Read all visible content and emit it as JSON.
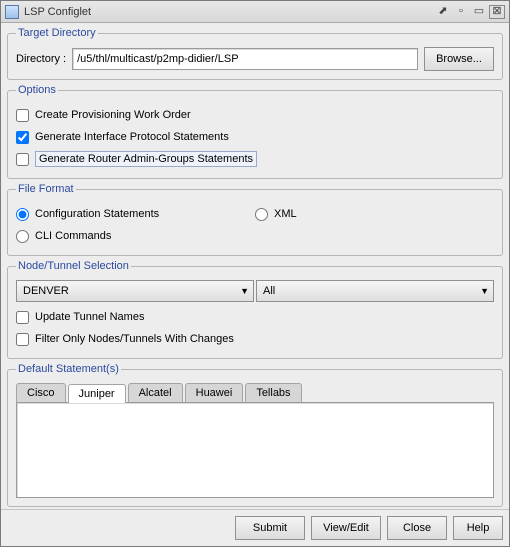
{
  "window": {
    "title": "LSP Configlet"
  },
  "target_directory": {
    "legend": "Target Directory",
    "label": "Directory :",
    "value": "/u5/thl/multicast/p2mp-didier/LSP",
    "browse": "Browse..."
  },
  "options": {
    "legend": "Options",
    "create_provisioning": "Create Provisioning Work Order",
    "gen_interface": "Generate Interface Protocol Statements",
    "gen_router_admin": "Generate Router Admin-Groups Statements"
  },
  "file_format": {
    "legend": "File Format",
    "config_stmts": "Configuration Statements",
    "xml": "XML",
    "cli": "CLI Commands"
  },
  "node_tunnel": {
    "legend": "Node/Tunnel Selection",
    "node_value": "DENVER",
    "tunnel_value": "All",
    "update_tunnel": "Update Tunnel Names",
    "filter_changes": "Filter Only Nodes/Tunnels With Changes"
  },
  "defaults": {
    "legend": "Default Statement(s)",
    "tabs": {
      "cisco": "Cisco",
      "juniper": "Juniper",
      "alcatel": "Alcatel",
      "huawei": "Huawei",
      "tellabs": "Tellabs"
    }
  },
  "footer": {
    "submit": "Submit",
    "view_edit": "View/Edit",
    "close": "Close",
    "help": "Help"
  }
}
